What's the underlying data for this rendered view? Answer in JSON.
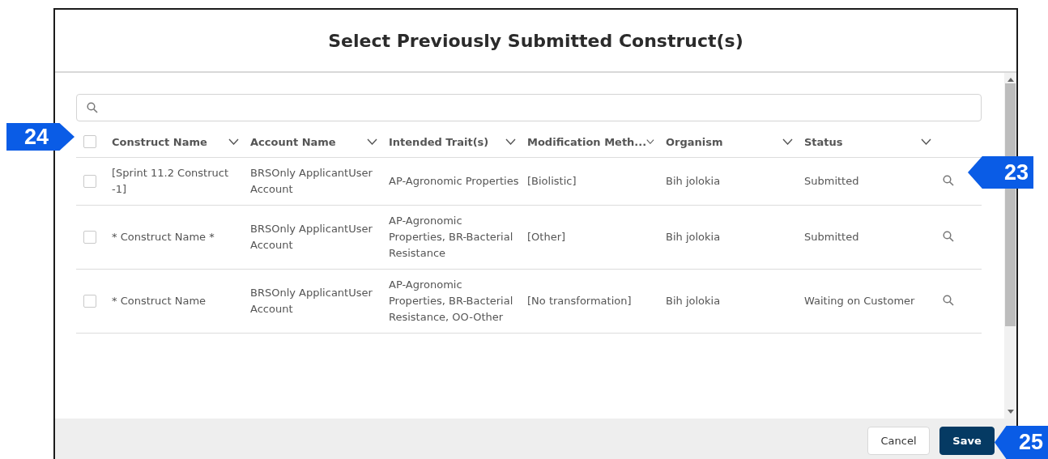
{
  "dialog": {
    "title": "Select Previously Submitted Construct(s)"
  },
  "table": {
    "select_all": {
      "checked": false
    },
    "columns": [
      "Construct Name",
      "Account Name",
      "Intended Trait(s)",
      "Modification Meth...",
      "Organism",
      "Status"
    ],
    "rows": [
      {
        "checked": false,
        "cells": [
          "[Sprint 11.2 Construct -1]",
          "BRSOnly ApplicantUser Account",
          "AP-Agronomic Properties",
          "[Biolistic]",
          "Bih jolokia",
          "Submitted"
        ]
      },
      {
        "checked": false,
        "cells": [
          "* Construct Name *",
          "BRSOnly ApplicantUser Account",
          "AP-Agronomic Properties, BR-Bacterial Resistance",
          "[Other]",
          "Bih jolokia",
          "Submitted"
        ]
      },
      {
        "checked": false,
        "cells": [
          "* Construct Name",
          "BRSOnly ApplicantUser Account",
          "AP-Agronomic Properties, BR-Bacterial Resistance, OO-Other",
          "[No transformation]",
          "Bih jolokia",
          "Waiting on Customer"
        ]
      }
    ]
  },
  "footer": {
    "buttons": [
      {
        "label": "Cancel",
        "kind": "secondary"
      },
      {
        "label": "Save",
        "kind": "primary"
      }
    ]
  },
  "callouts": [
    {
      "label": "24",
      "kind": "right"
    },
    {
      "label": "23",
      "kind": "left"
    },
    {
      "label": "25",
      "kind": "left"
    }
  ]
}
